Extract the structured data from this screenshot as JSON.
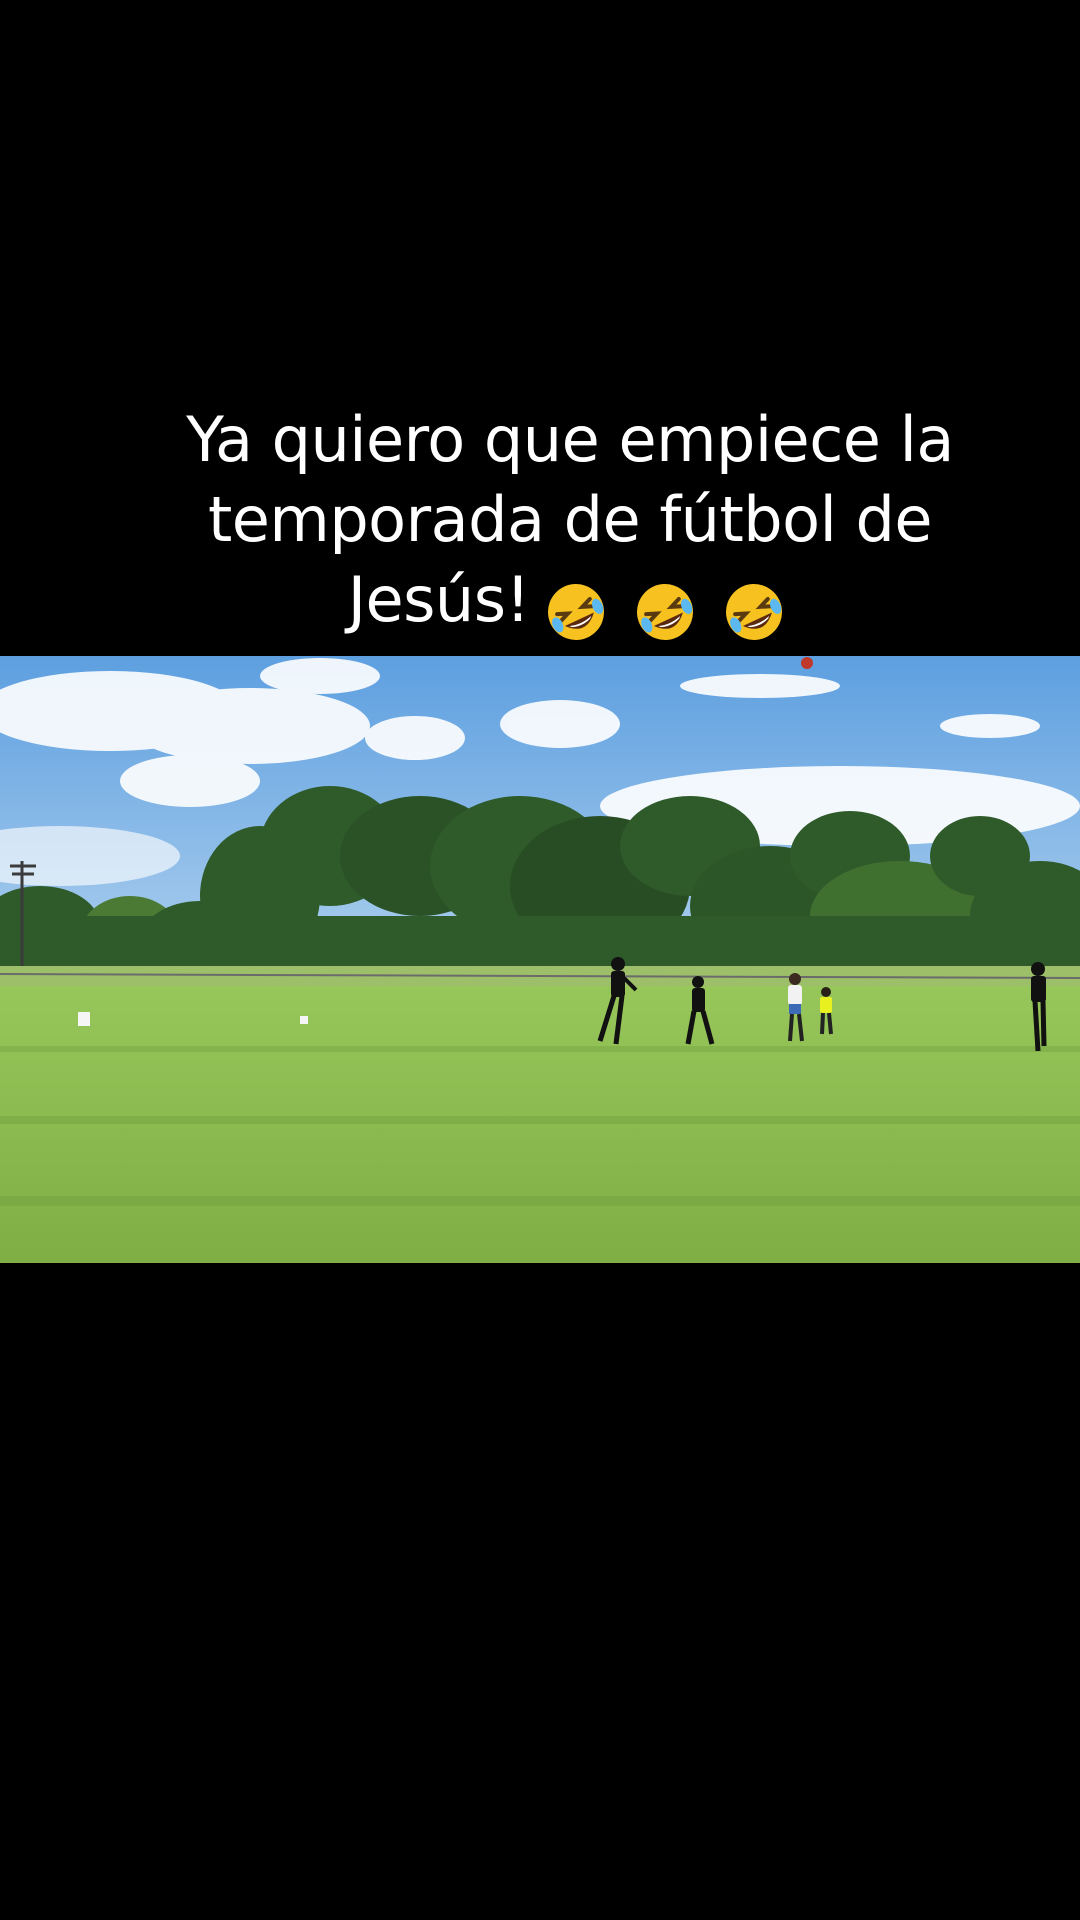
{
  "caption": {
    "line1": "Ya quiero que empiece la",
    "line2": "temporada de fútbol de",
    "line3": "Jesús!",
    "emoji": "rolling-on-floor-laughing-face",
    "emoji_count": 3
  },
  "video": {
    "scene": "soccer-field",
    "colors": {
      "sky": "#7fb6e8",
      "grass": "#8cbd4e",
      "trees": "#2f5a2a",
      "background": "#000000"
    }
  }
}
